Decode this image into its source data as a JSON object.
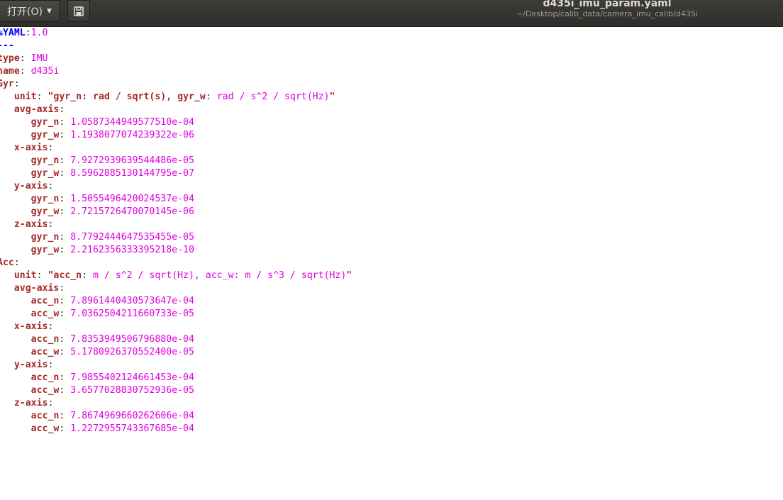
{
  "toolbar": {
    "open_label": "打开(O)",
    "open_dropdown_icon": "chevron-down-icon",
    "pin_icon": "document-save-icon"
  },
  "window": {
    "title": "d435i_imu_param.yaml",
    "path": "~/Desktop/calib_data/camera_imu_calib/d435i"
  },
  "colors": {
    "keyword": "#a52a2a",
    "value": "#e000e0",
    "directive": "#0000ff",
    "text": "#2e3436",
    "titlebar": "#3c3b37"
  },
  "editor": {
    "lines": [
      {
        "indent": "",
        "directive": "%YAML",
        "sep": ":",
        "value": "1.0"
      },
      {
        "indent": "",
        "plain": "---"
      },
      {
        "indent": "",
        "key": "type",
        "sep": ": ",
        "value": "IMU"
      },
      {
        "indent": "",
        "key": "name",
        "sep": ": ",
        "value": "d435i"
      },
      {
        "indent": "",
        "key": "Gyr",
        "sep": ":"
      },
      {
        "indent": "   ",
        "key": "unit",
        "sep": ": ",
        "str_a": "\"gyr_n: rad / sqrt(s), gyr_w",
        "sep2": ": ",
        "str_b": "rad / s^2 / sqrt(Hz)",
        "str_c": "\""
      },
      {
        "indent": "   ",
        "key": "avg-axis",
        "sep": ":"
      },
      {
        "indent": "      ",
        "key": "gyr_n",
        "sep": ": ",
        "value": "1.0587344949577510e-04"
      },
      {
        "indent": "      ",
        "key": "gyr_w",
        "sep": ": ",
        "value": "1.1938077074239322e-06"
      },
      {
        "indent": "   ",
        "key": "x-axis",
        "sep": ":"
      },
      {
        "indent": "      ",
        "key": "gyr_n",
        "sep": ": ",
        "value": "7.9272939639544486e-05"
      },
      {
        "indent": "      ",
        "key": "gyr_w",
        "sep": ": ",
        "value": "8.5962885130144795e-07"
      },
      {
        "indent": "   ",
        "key": "y-axis",
        "sep": ":"
      },
      {
        "indent": "      ",
        "key": "gyr_n",
        "sep": ": ",
        "value": "1.5055496420024537e-04"
      },
      {
        "indent": "      ",
        "key": "gyr_w",
        "sep": ": ",
        "value": "2.7215726470070145e-06"
      },
      {
        "indent": "   ",
        "key": "z-axis",
        "sep": ":"
      },
      {
        "indent": "      ",
        "key": "gyr_n",
        "sep": ": ",
        "value": "8.7792444647535455e-05"
      },
      {
        "indent": "      ",
        "key": "gyr_w",
        "sep": ": ",
        "value": "2.2162356333395218e-10"
      },
      {
        "indent": "",
        "key": "Acc",
        "sep": ":"
      },
      {
        "indent": "   ",
        "key": "unit",
        "sep": ": ",
        "str_a": "\"acc_n",
        "sep2": ": ",
        "str_b": "m / s^2 / sqrt(Hz), acc_w: m / s^3 / sqrt(Hz)",
        "str_c": "\""
      },
      {
        "indent": "   ",
        "key": "avg-axis",
        "sep": ":"
      },
      {
        "indent": "      ",
        "key": "acc_n",
        "sep": ": ",
        "value": "7.8961440430573647e-04"
      },
      {
        "indent": "      ",
        "key": "acc_w",
        "sep": ": ",
        "value": "7.0362504211660733e-05"
      },
      {
        "indent": "   ",
        "key": "x-axis",
        "sep": ":"
      },
      {
        "indent": "      ",
        "key": "acc_n",
        "sep": ": ",
        "value": "7.8353949506796880e-04"
      },
      {
        "indent": "      ",
        "key": "acc_w",
        "sep": ": ",
        "value": "5.1780926370552400e-05"
      },
      {
        "indent": "   ",
        "key": "y-axis",
        "sep": ":"
      },
      {
        "indent": "      ",
        "key": "acc_n",
        "sep": ": ",
        "value": "7.9855402124661453e-04"
      },
      {
        "indent": "      ",
        "key": "acc_w",
        "sep": ": ",
        "value": "3.6577028830752936e-05"
      },
      {
        "indent": "   ",
        "key": "z-axis",
        "sep": ":"
      },
      {
        "indent": "      ",
        "key": "acc_n",
        "sep": ": ",
        "value": "7.8674969660262606e-04"
      },
      {
        "indent": "      ",
        "key": "acc_w",
        "sep": ": ",
        "value": "1.2272955743367685e-04"
      }
    ]
  }
}
